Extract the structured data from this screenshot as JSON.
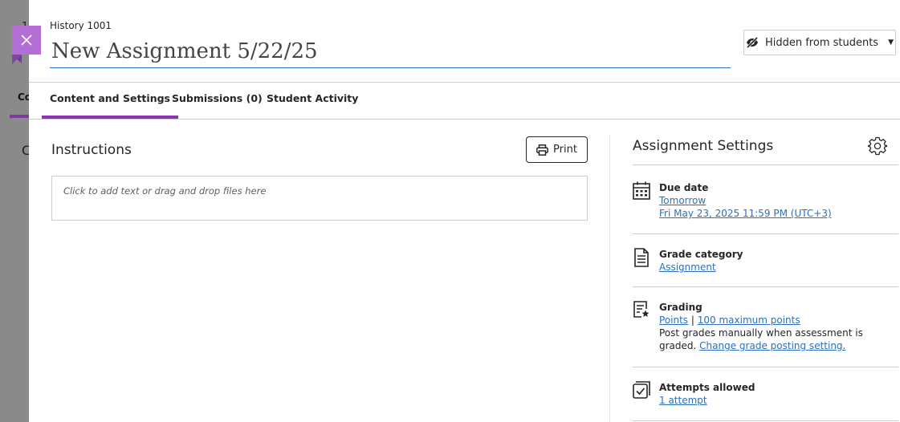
{
  "background": {
    "char_top": "1",
    "tab_fragment": "Co",
    "heading_fragment": "C"
  },
  "header": {
    "course": "History 1001",
    "title": "New Assignment 5/22/25",
    "visibility": "Hidden from students"
  },
  "tabs": [
    {
      "label": "Content and Settings"
    },
    {
      "label": "Submissions (0)"
    },
    {
      "label": "Student Activity"
    }
  ],
  "instructions": {
    "heading": "Instructions",
    "print_label": "Print",
    "placeholder": "Click to add text or drag and drop files here"
  },
  "settings": {
    "heading": "Assignment Settings",
    "due": {
      "title": "Due date",
      "relative": "Tomorrow",
      "absolute": "Fri May 23, 2025 11:59 PM (UTC+3)"
    },
    "category": {
      "title": "Grade category",
      "value": "Assignment"
    },
    "grading": {
      "title": "Grading",
      "points": "Points",
      "separator": "|",
      "max": "100 maximum points",
      "note": "Post grades manually when assessment is graded.",
      "change_link": "Change grade posting setting."
    },
    "attempts": {
      "title": "Attempts allowed",
      "value": "1 attempt"
    }
  },
  "colors": {
    "accent": "#8a36b3",
    "link": "#2c6fbd",
    "close_flag": "#b46fd6"
  },
  "icons": [
    "close-icon",
    "eye-slash-icon",
    "caret-down-icon",
    "printer-icon",
    "gear-icon",
    "calendar-icon",
    "document-icon",
    "grading-star-icon",
    "attempts-checkbox-icon"
  ]
}
